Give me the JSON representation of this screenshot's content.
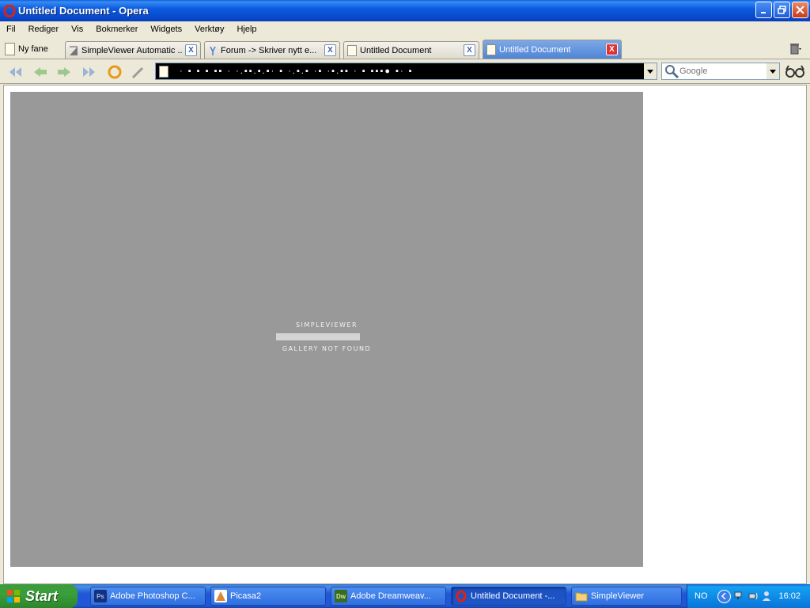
{
  "window": {
    "title": "Untitled Document - Opera"
  },
  "menu": [
    "Fil",
    "Rediger",
    "Vis",
    "Bokmerker",
    "Widgets",
    "Verktøy",
    "Hjelp"
  ],
  "tabs": {
    "new_tab_label": "Ny fane",
    "items": [
      {
        "label": "SimpleViewer Automatic ...",
        "active": false
      },
      {
        "label": "Forum -> Skriver nytt e...",
        "active": false
      },
      {
        "label": "Untitled Document",
        "active": false
      },
      {
        "label": "Untitled Document",
        "active": true
      }
    ]
  },
  "address": {
    "value": "· ▪ ▪ ▪   ▪▪ · ·.▪▪.▪.▪· ▪ ·.▪.▪ ·▪ ·▪.▪▪ · ▪ ▪▪▪●   ▪· ▪"
  },
  "search": {
    "placeholder": "Google"
  },
  "viewer": {
    "title": "SIMPLEVIEWER",
    "message": "GALLERY NOT FOUND",
    "progress": 1.0
  },
  "taskbar": {
    "start_label": "Start",
    "tasks": [
      {
        "label": "Adobe Photoshop C...",
        "icon": "Ps",
        "active": false
      },
      {
        "label": "Picasa2",
        "icon": "picasa-icon",
        "active": false
      },
      {
        "label": "Adobe Dreamweav...",
        "icon": "Dw",
        "active": false
      },
      {
        "label": "Untitled Document -...",
        "icon": "opera-icon",
        "active": true
      },
      {
        "label": "SimpleViewer",
        "icon": "folder-icon",
        "active": false
      }
    ],
    "language": "NO",
    "clock": "16:02"
  }
}
